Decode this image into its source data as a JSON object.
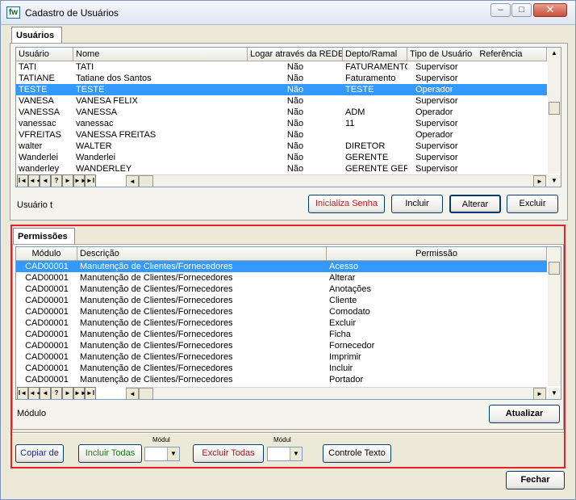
{
  "window": {
    "title": "Cadastro de Usuários",
    "app_icon_text": "fw",
    "controls": {
      "minimize": "–",
      "maximize": "□",
      "close": "✕"
    }
  },
  "usuarios_tab": {
    "label": "Usuários"
  },
  "users_grid": {
    "columns": [
      "Usuário",
      "Nome",
      "Logar através da REDE",
      "Depto/Ramal",
      "Tipo de Usuário",
      "Referência"
    ],
    "rows": [
      {
        "usuario": "TATI",
        "nome": "TATI",
        "rede": "Não",
        "depto": "FATURAMENTO",
        "tipo": "Supervisor"
      },
      {
        "usuario": "TATIANE",
        "nome": "Tatiane dos Santos",
        "rede": "Não",
        "depto": "Faturamento",
        "tipo": "Supervisor"
      },
      {
        "usuario": "TESTE",
        "nome": "TESTE",
        "rede": "Não",
        "depto": "TESTE",
        "tipo": "Operador",
        "selected": true
      },
      {
        "usuario": "VANESA",
        "nome": "VANESA FELIX",
        "rede": "Não",
        "depto": "",
        "tipo": "Supervisor"
      },
      {
        "usuario": "VANESSA",
        "nome": "VANESSA",
        "rede": "Não",
        "depto": "ADM",
        "tipo": "Operador"
      },
      {
        "usuario": "vanessac",
        "nome": "vanessac",
        "rede": "Não",
        "depto": "11",
        "tipo": "Supervisor"
      },
      {
        "usuario": "VFREITAS",
        "nome": "VANESSA FREITAS",
        "rede": "Não",
        "depto": "",
        "tipo": "Operador"
      },
      {
        "usuario": "walter",
        "nome": "WALTER",
        "rede": "Não",
        "depto": "DIRETOR",
        "tipo": "Supervisor"
      },
      {
        "usuario": "Wanderlei",
        "nome": "Wanderlei",
        "rede": "Não",
        "depto": "GERENTE",
        "tipo": "Supervisor"
      },
      {
        "usuario": "wanderley",
        "nome": "WANDERLEY",
        "rede": "Não",
        "depto": "GERENTE GERAL",
        "tipo": "Supervisor"
      }
    ]
  },
  "navigator": [
    "I◄",
    "◄◄",
    "◄",
    "?",
    "►",
    "►►",
    "►I"
  ],
  "users_footer": {
    "usuario_label": "Usuário  t",
    "inicializa_senha": "Inicializa Senha",
    "incluir": "Incluir",
    "alterar": "Alterar",
    "excluir": "Excluir"
  },
  "permissoes_tab": {
    "label": "Permissões"
  },
  "perm_grid": {
    "columns": [
      "Módulo",
      "Descrição",
      "Permissão"
    ],
    "rows": [
      {
        "modulo": "CAD00001",
        "descricao": "Manutenção de Clientes/Fornecedores",
        "permissao": "Acesso",
        "selected": true
      },
      {
        "modulo": "CAD00001",
        "descricao": "Manutenção de Clientes/Fornecedores",
        "permissao": "Alterar"
      },
      {
        "modulo": "CAD00001",
        "descricao": "Manutenção de Clientes/Fornecedores",
        "permissao": "Anotações"
      },
      {
        "modulo": "CAD00001",
        "descricao": "Manutenção de Clientes/Fornecedores",
        "permissao": "Cliente"
      },
      {
        "modulo": "CAD00001",
        "descricao": "Manutenção de Clientes/Fornecedores",
        "permissao": "Comodato"
      },
      {
        "modulo": "CAD00001",
        "descricao": "Manutenção de Clientes/Fornecedores",
        "permissao": "Excluir"
      },
      {
        "modulo": "CAD00001",
        "descricao": "Manutenção de Clientes/Fornecedores",
        "permissao": "Ficha"
      },
      {
        "modulo": "CAD00001",
        "descricao": "Manutenção de Clientes/Fornecedores",
        "permissao": "Fornecedor"
      },
      {
        "modulo": "CAD00001",
        "descricao": "Manutenção de Clientes/Fornecedores",
        "permissao": "Imprimir"
      },
      {
        "modulo": "CAD00001",
        "descricao": "Manutenção de Clientes/Fornecedores",
        "permissao": "Incluir"
      },
      {
        "modulo": "CAD00001",
        "descricao": "Manutenção de Clientes/Fornecedores",
        "permissao": "Portador"
      }
    ]
  },
  "perm_footer": {
    "modulo_label": "Módulo",
    "atualizar": "Atualizar"
  },
  "bottom_bar": {
    "copiar_de": "Copiar de",
    "incluir_todas": "Incluir Todas",
    "modulo_small_1": "Módul",
    "excluir_todas": "Excluir Todas",
    "modulo_small_2": "Módul",
    "controle_texto": "Controle Texto"
  },
  "fechar": "Fechar",
  "colors": {
    "selection": "#3399ff",
    "highlight_box": "#e8202a",
    "inicializa_text": "#d6161c",
    "copiar_text": "#1a2a8a",
    "incluir_todas_text": "#1c7a1c",
    "excluir_todas_text": "#a01818"
  }
}
